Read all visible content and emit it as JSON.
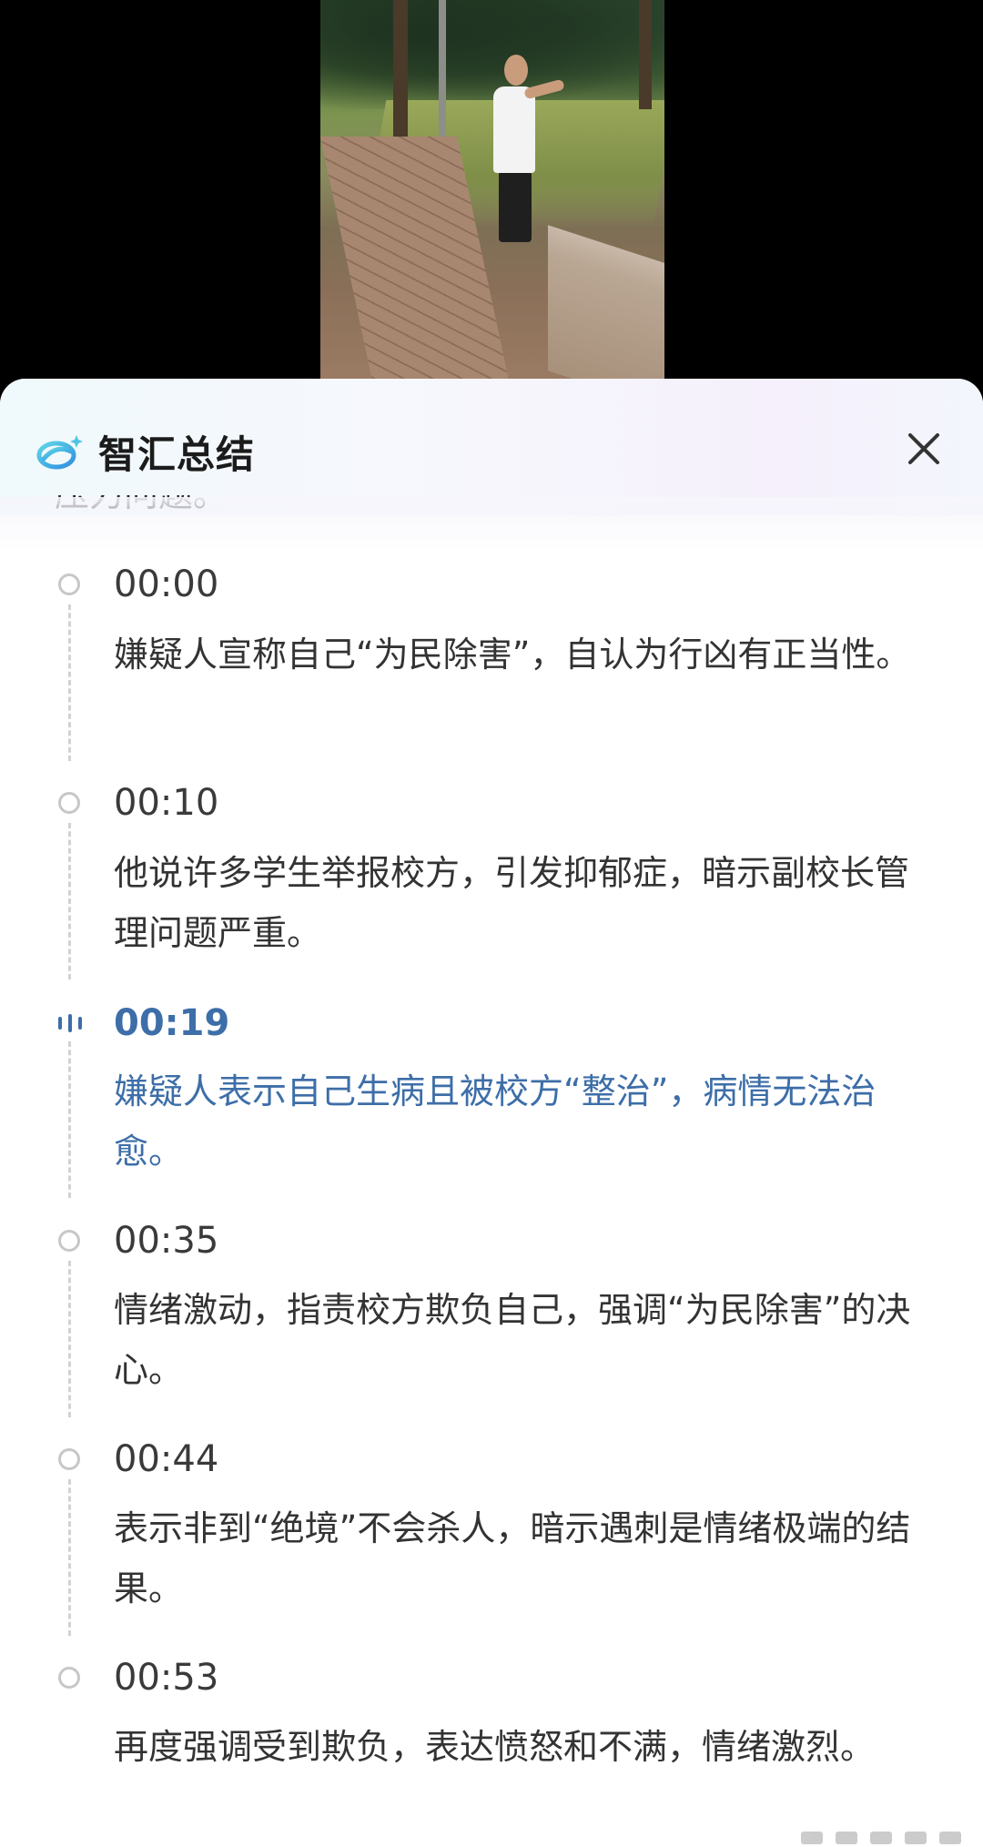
{
  "panel": {
    "title": "智汇总结",
    "clipped_text": "压力问题。"
  },
  "timeline": [
    {
      "time": "00:00",
      "text": "嫌疑人宣称自己“为民除害”，自认为行凶有正当性。",
      "active": false
    },
    {
      "time": "00:10",
      "text": "他说许多学生举报校方，引发抑郁症，暗示副校长管理问题严重。",
      "active": false
    },
    {
      "time": "00:19",
      "text": "嫌疑人表示自己生病且被校方“整治”，病情无法治愈。",
      "active": true
    },
    {
      "time": "00:35",
      "text": "情绪激动，指责校方欺负自己，强调“为民除害”的决心。",
      "active": false
    },
    {
      "time": "00:44",
      "text": "表示非到“绝境”不会杀人，暗示遇刺是情绪极端的结果。",
      "active": false
    },
    {
      "time": "00:53",
      "text": "再度强调受到欺负，表达愤怒和不满，情绪激烈。",
      "active": false
    }
  ],
  "colors": {
    "accent": "#3d6ea8",
    "text": "#333333",
    "dot": "#c7c7c7"
  },
  "icons": {
    "logo": "zhihui-logo-icon",
    "close": "close-icon",
    "playing": "playing-bars-icon",
    "timeline_dot": "timeline-dot-icon"
  }
}
